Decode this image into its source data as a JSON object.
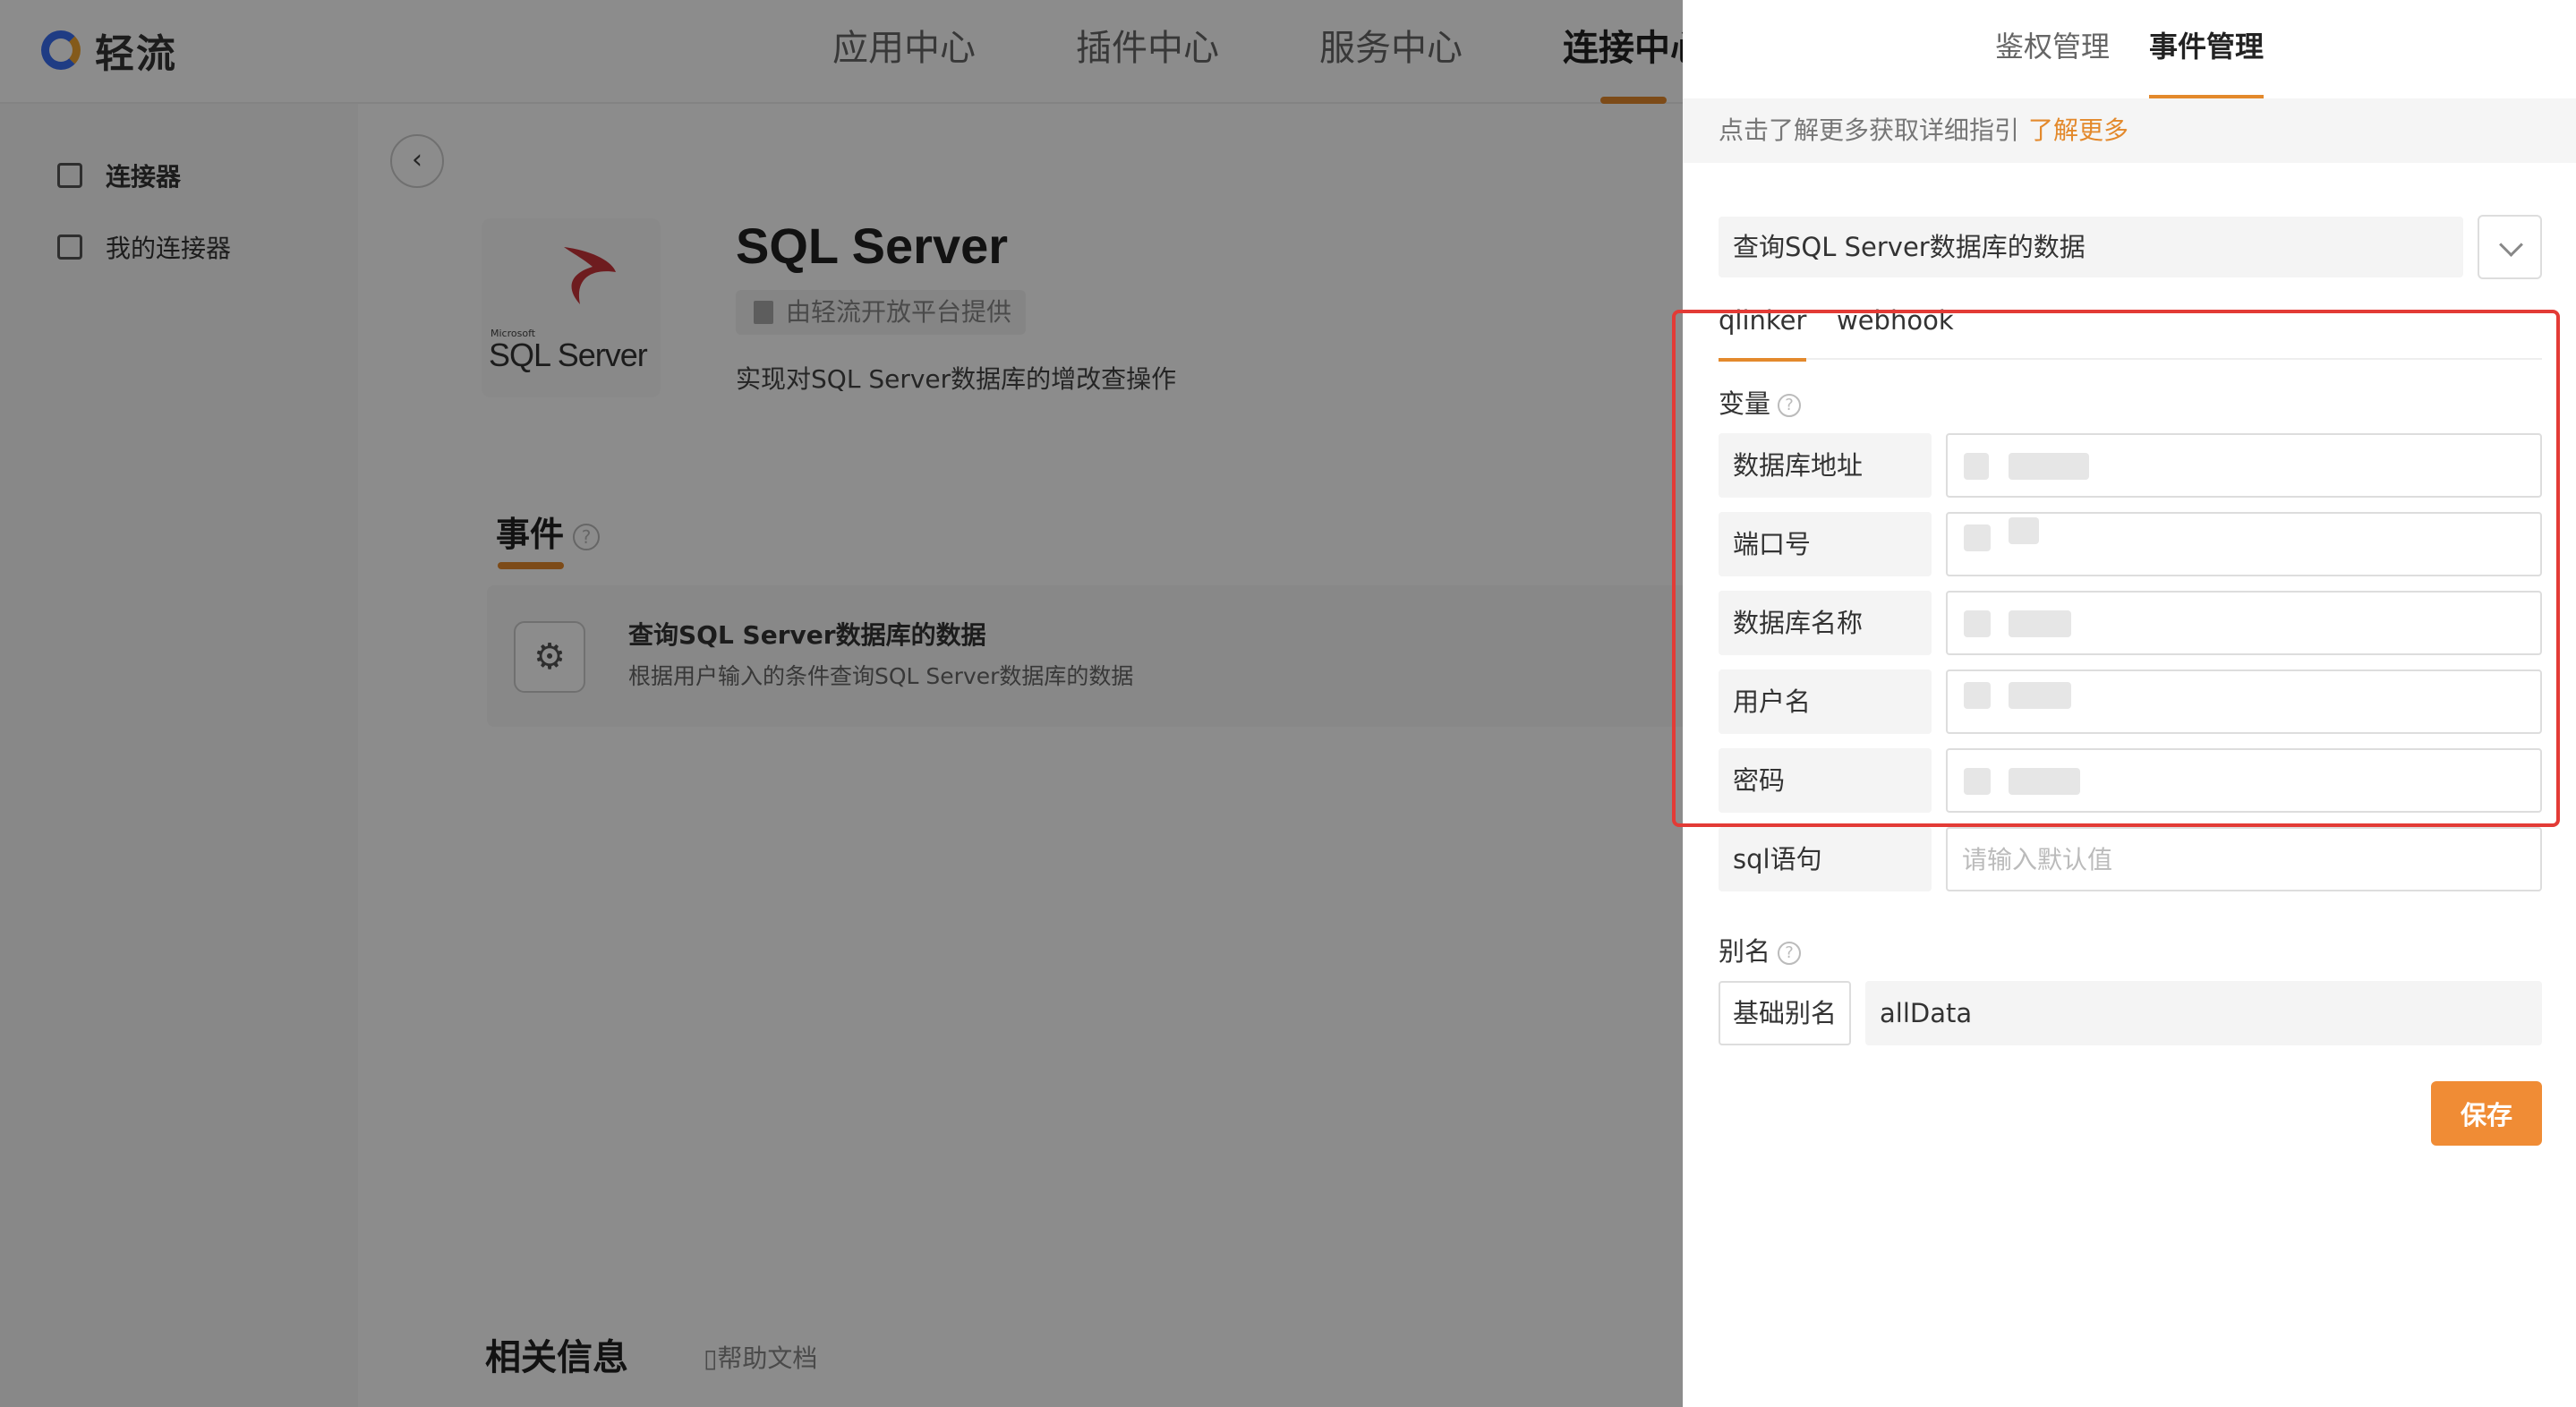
{
  "app": {
    "name": "轻流"
  },
  "topnav": {
    "items": [
      "应用中心",
      "插件中心",
      "服务中心",
      "连接中心"
    ],
    "active_index": 3
  },
  "sidebar": {
    "items": [
      {
        "label": "连接器",
        "active": true
      },
      {
        "label": "我的连接器",
        "active": false
      }
    ]
  },
  "product": {
    "logo_small": "Microsoft",
    "logo_text": "SQL Server",
    "title": "SQL Server",
    "provider": "由轻流开放平台提供",
    "description": "实现对SQL Server数据库的增改查操作"
  },
  "events_section": {
    "title": "事件",
    "event": {
      "name": "查询SQL Server数据库的数据",
      "description": "根据用户输入的条件查询SQL Server数据库的数据"
    }
  },
  "related": {
    "title": "相关信息",
    "help_doc": "帮助文档"
  },
  "drawer": {
    "tabs": [
      "鉴权管理",
      "事件管理"
    ],
    "active_tab": 1,
    "hint": "点击了解更多获取详细指引",
    "hint_link": "了解更多",
    "selected_event": "查询SQL Server数据库的数据",
    "subtabs": [
      "qlinker",
      "webhook"
    ],
    "variables_label": "变量",
    "variables": [
      {
        "name": "数据库地址",
        "value": "",
        "placeholder": ""
      },
      {
        "name": "端口号",
        "value": "",
        "placeholder": ""
      },
      {
        "name": "数据库名称",
        "value": "",
        "placeholder": ""
      },
      {
        "name": "用户名",
        "value": "",
        "placeholder": ""
      },
      {
        "name": "密码",
        "value": "",
        "placeholder": ""
      },
      {
        "name": "sql语句",
        "value": "",
        "placeholder": "请输入默认值"
      }
    ],
    "alias_label": "别名",
    "alias_tag": "基础别名",
    "alias_value": "allData",
    "save_label": "保存",
    "colors": {
      "accent": "#e3892c",
      "save": "#f08c35",
      "highlight": "#e33b36"
    }
  }
}
